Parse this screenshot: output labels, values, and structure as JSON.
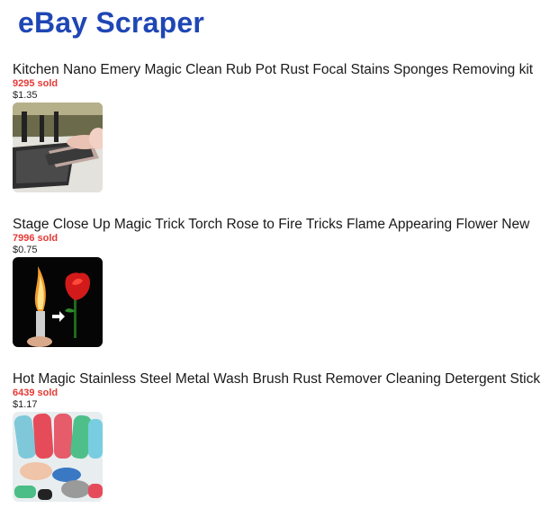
{
  "header": {
    "title": "eBay Scraper"
  },
  "items": [
    {
      "title": "Kitchen Nano Emery Magic Clean Rub Pot Rust Focal Stains Sponges Removing kit",
      "sold": "9295 sold",
      "price": "$1.35",
      "image_icon": "sponge-cleaning-photo"
    },
    {
      "title": "Stage Close Up Magic Trick Torch Rose to Fire Tricks Flame Appearing Flower New",
      "sold": "7996 sold",
      "price": "$0.75",
      "image_icon": "fire-rose-photo"
    },
    {
      "title": "Hot Magic Stainless Steel Metal Wash Brush Rust Remover Cleaning Detergent Stick",
      "sold": "6439 sold",
      "price": "$1.17",
      "image_icon": "cleaning-sticks-photo"
    }
  ],
  "colors": {
    "title": "#1f46b5",
    "sold": "#e53935"
  }
}
